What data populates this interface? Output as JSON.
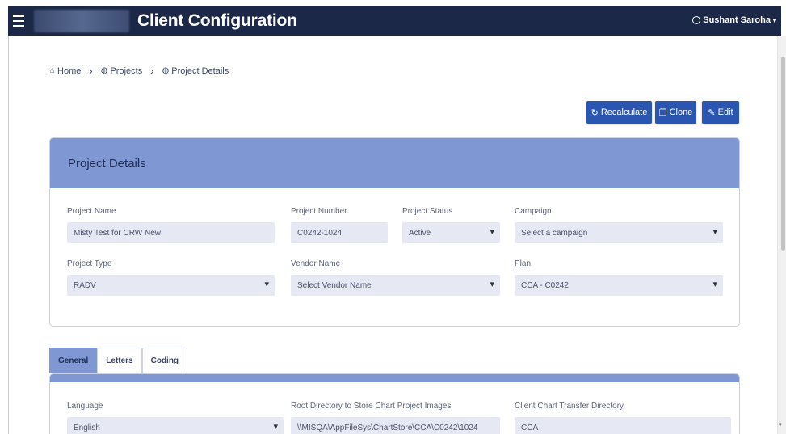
{
  "app": {
    "title": "Client Configuration",
    "user_name": "Sushant Saroha"
  },
  "breadcrumb": [
    {
      "label": "Home"
    },
    {
      "label": "Projects"
    },
    {
      "label": "Project Details"
    }
  ],
  "actions": {
    "recalculate": "Recalculate",
    "clone": "Clone",
    "edit": "Edit"
  },
  "project": {
    "section_title": "Project Details",
    "fields": {
      "project_name": {
        "label": "Project Name",
        "value": "Misty Test for CRW New"
      },
      "project_number": {
        "label": "Project Number",
        "value": "C0242-1024"
      },
      "project_status": {
        "label": "Project Status",
        "value": "Active"
      },
      "campaign": {
        "label": "Campaign",
        "value": "Select a campaign"
      },
      "project_type": {
        "label": "Project Type",
        "value": "RADV"
      },
      "vendor_name": {
        "label": "Vendor Name",
        "value": "Select Vendor Name"
      },
      "plan": {
        "label": "Plan",
        "value": "CCA - C0242"
      }
    }
  },
  "tabs": [
    {
      "label": "General",
      "active": true
    },
    {
      "label": "Letters",
      "active": false
    },
    {
      "label": "Coding",
      "active": false
    }
  ],
  "general": {
    "language": {
      "label": "Language",
      "value": "English"
    },
    "root_directory": {
      "label": "Root Directory to Store Chart Project Images",
      "value": "\\\\MISQA\\AppFileSys\\ChartStore\\CCA\\C0242\\1024"
    },
    "transfer_directory": {
      "label": "Client Chart Transfer Directory",
      "value": "CCA"
    }
  },
  "colors": {
    "topbar": "#1c2847",
    "accent": "#2a55b0",
    "section_header": "#7f98d4",
    "field_bg": "#e6e9f4"
  }
}
